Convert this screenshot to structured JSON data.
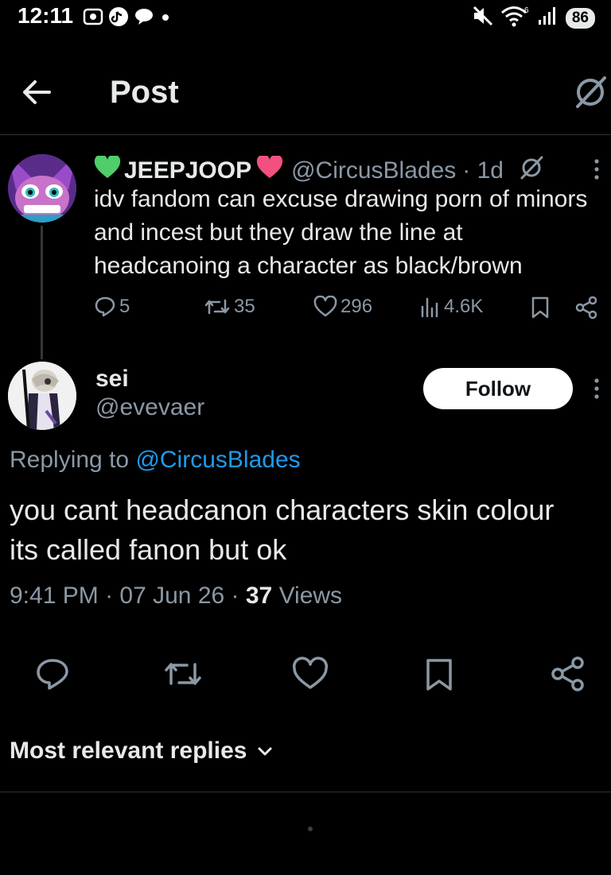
{
  "status_bar": {
    "time": "12:11",
    "battery": "86",
    "network": "6"
  },
  "header": {
    "title": "Post"
  },
  "quoted_tweet": {
    "display_name": "JEEPJOOP",
    "handle": "@CircusBlades",
    "age": "· 1d",
    "text": "idv fandom can excuse drawing porn of minors and incest but they draw the line at headcanoing a character as black/brown",
    "replies": "5",
    "reposts": "35",
    "likes": "296",
    "views": "4.6K"
  },
  "main_tweet": {
    "display_name": "sei",
    "handle": "@evevaer",
    "follow_label": "Follow",
    "replying_prefix": "Replying to ",
    "replying_to": "@CircusBlades",
    "text_line1": "you cant headcanon characters skin colour",
    "text_line2": "its called fanon but ok",
    "time": "9:41 PM",
    "date": "07 Jun 26",
    "views_count": "37",
    "views_label": "Views"
  },
  "replies_section": {
    "sort_label": "Most relevant replies"
  },
  "colors": {
    "background": "#000000",
    "text": "#e7e9ea",
    "muted": "#8b98a5",
    "link": "#1d9bf0",
    "divider": "#2f3336"
  }
}
